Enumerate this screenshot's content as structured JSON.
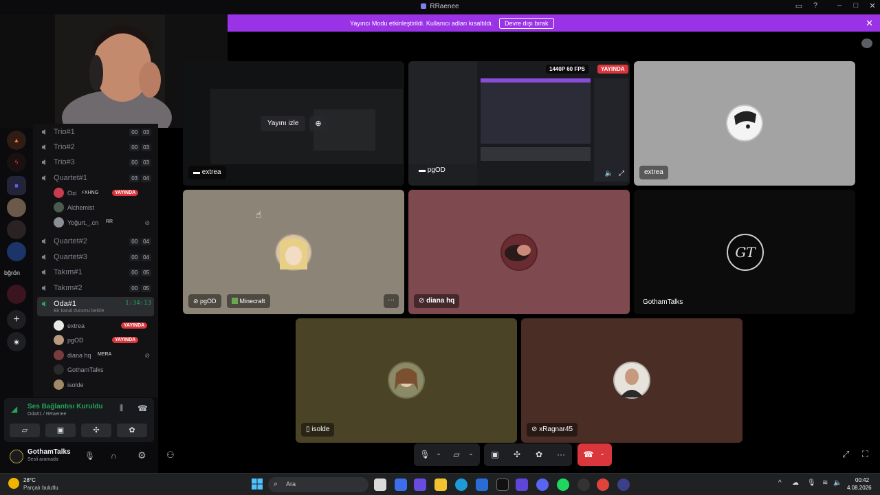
{
  "window": {
    "title": "RRaenee"
  },
  "banner": {
    "message": "Yayıncı Modu etkinleştirildi. Kullanıcı adları kısaltıldı.",
    "button": "Devre dışı bırak"
  },
  "rail": {
    "folder_label": "bğrön"
  },
  "channels": [
    {
      "name": "Trio#1",
      "counts": [
        "00",
        "03"
      ]
    },
    {
      "name": "Trio#2",
      "counts": [
        "00",
        "03"
      ]
    },
    {
      "name": "Trio#3",
      "counts": [
        "00",
        "03"
      ]
    },
    {
      "name": "Quartet#1",
      "counts": [
        "03",
        "04"
      ]
    },
    {
      "name": "Quartet#2",
      "counts": [
        "00",
        "04"
      ]
    },
    {
      "name": "Quartet#3",
      "counts": [
        "00",
        "04"
      ]
    },
    {
      "name": "Takım#1",
      "counts": [
        "00",
        "05"
      ]
    },
    {
      "name": "Takım#2",
      "counts": [
        "00",
        "05"
      ]
    }
  ],
  "quartet_users": [
    {
      "name": "Oxi",
      "tag": "⚡XHNG",
      "live": "YAYINDA"
    },
    {
      "name": "Alchemist"
    },
    {
      "name": "Yoğurt._.cn",
      "tag": "RR"
    }
  ],
  "active_channel": {
    "name": "Oda#1",
    "timer": "1:34:13",
    "status_hint": "Bir kanal durumu belirle"
  },
  "oda_users": [
    {
      "name": "extrea",
      "live": "YAYINDA"
    },
    {
      "name": "pgOD",
      "live": "YAYINDA"
    },
    {
      "name": "diana hq",
      "tag": "MERA"
    },
    {
      "name": "GothamTalks"
    },
    {
      "name": "isolde"
    }
  ],
  "voice": {
    "title": "Ses Bağlantısı Kuruldu",
    "subtitle": "Oda#1 / RRaenee"
  },
  "user": {
    "name": "GothamTalks",
    "status": "Sesli aramada"
  },
  "tiles": {
    "t1": {
      "name": "extrea",
      "watch_button": "Yayını izle"
    },
    "t2": {
      "name": "pgOD",
      "badge_quality": "1440P 60 FPS",
      "badge_live": "YAYINDA"
    },
    "t3": {
      "name": "extrea"
    },
    "t4": {
      "name": "pgOD",
      "activity": "Minecraft"
    },
    "t5": {
      "name": "diana hq"
    },
    "t6": {
      "name": "GothamTalks",
      "logo_text": "GT"
    },
    "t7": {
      "name": "isolde"
    },
    "t8": {
      "name": "xRagnar45"
    }
  },
  "taskbar": {
    "weather_temp": "28°C",
    "weather_desc": "Parçalı bulutlu",
    "search_placeholder": "Ara",
    "time": "00:42",
    "date": "4.08.2026"
  },
  "colors": {
    "banner": "#9a33e6",
    "live": "#da373c",
    "connected": "#23a55a",
    "hangup": "#da373c"
  }
}
